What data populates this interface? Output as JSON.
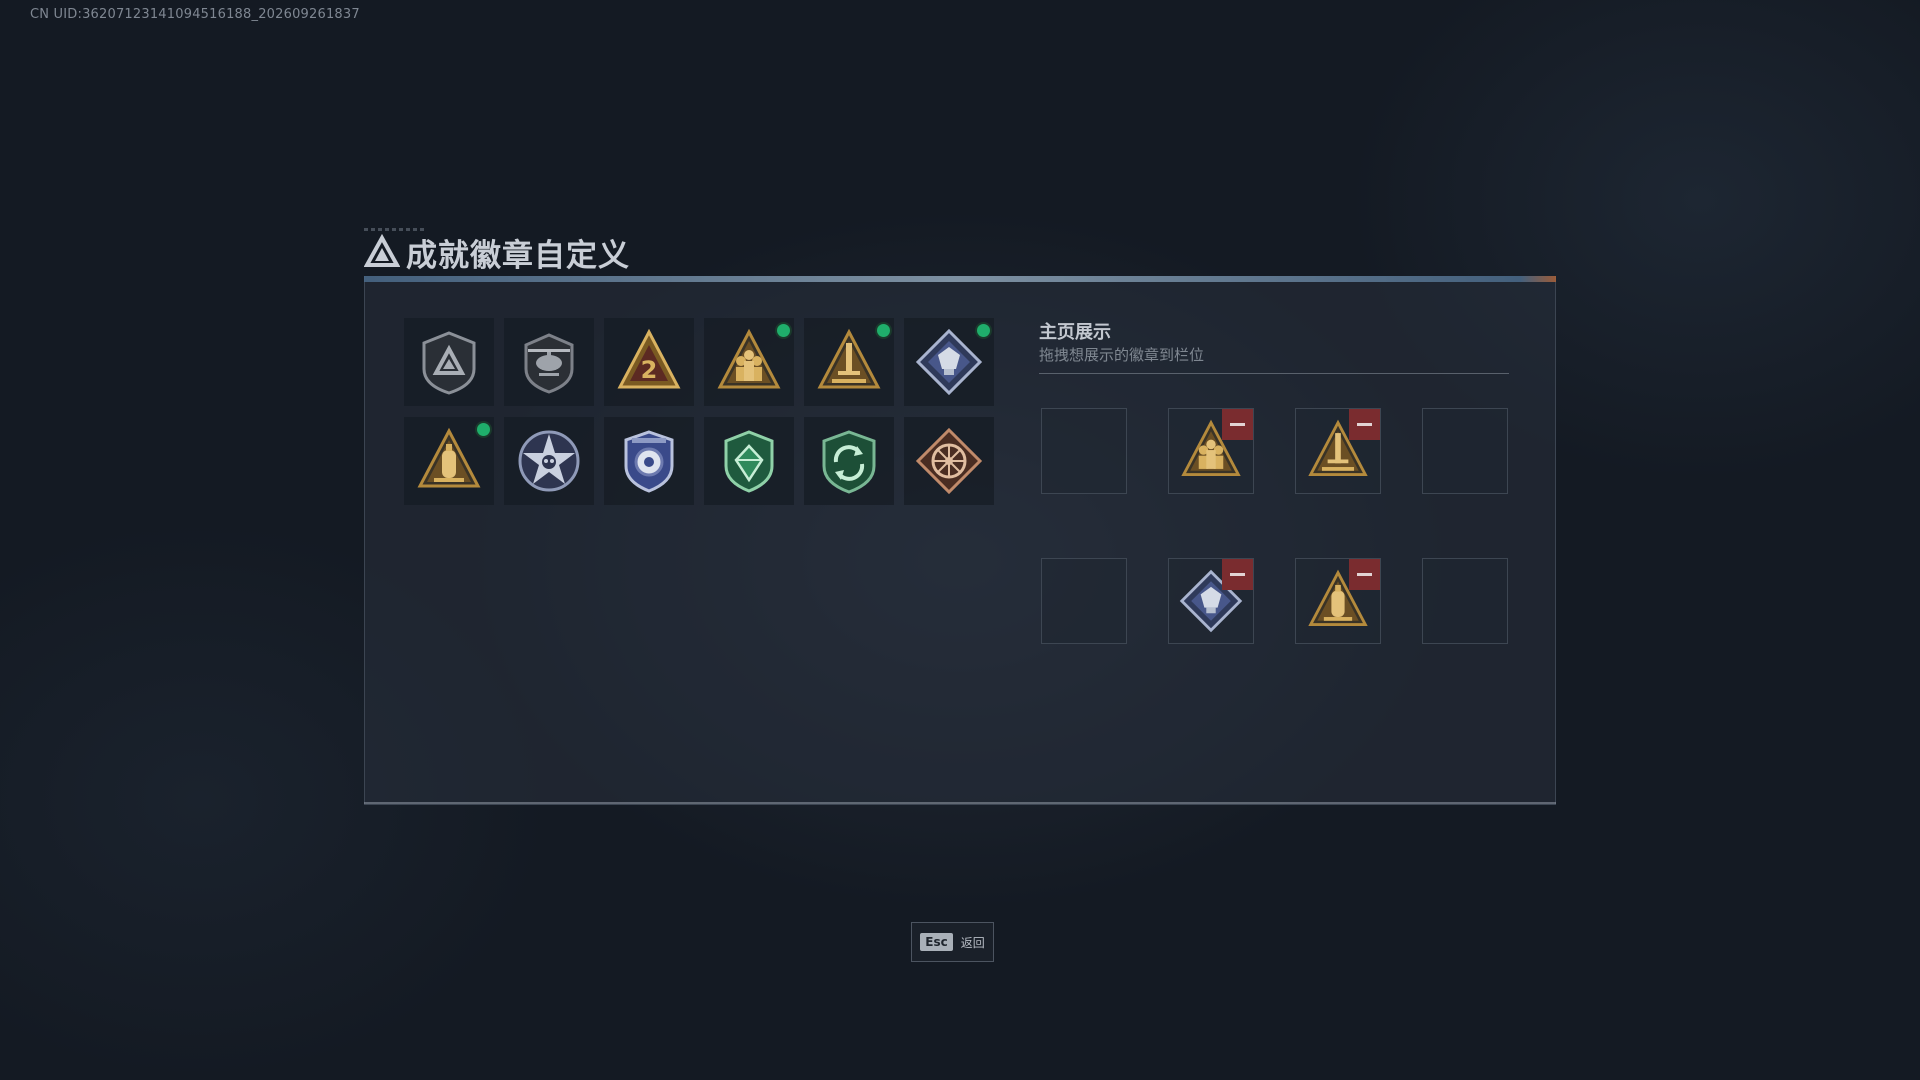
{
  "uid_text": "CN UID:36207123141094516188_202609261837",
  "title": "成就徽章自定义",
  "showcase": {
    "title": "主页展示",
    "subtitle": "拖拽想展示的徽章到栏位"
  },
  "badges": [
    {
      "icon": "triangle-shield-badge-icon",
      "equipped": false
    },
    {
      "icon": "helicopter-shield-badge-icon",
      "equipped": false
    },
    {
      "icon": "number-2-triangle-badge-icon",
      "equipped": false
    },
    {
      "icon": "soldiers-triangle-badge-icon",
      "equipped": true
    },
    {
      "icon": "sword-triangle-badge-icon",
      "equipped": true
    },
    {
      "icon": "diamond-emblem-badge-icon",
      "equipped": true
    },
    {
      "icon": "oxygen-tank-triangle-badge-icon",
      "equipped": true
    },
    {
      "icon": "star-skull-badge-icon",
      "equipped": false
    },
    {
      "icon": "blue-police-badge-icon",
      "equipped": false
    },
    {
      "icon": "green-gem-shield-badge-icon",
      "equipped": false
    },
    {
      "icon": "green-cycle-shield-badge-icon",
      "equipped": false
    },
    {
      "icon": "wheel-diamond-badge-icon",
      "equipped": false
    }
  ],
  "slots": [
    {
      "filled": false
    },
    {
      "filled": true,
      "icon": "soldiers-triangle-badge-icon"
    },
    {
      "filled": true,
      "icon": "sword-triangle-badge-icon"
    },
    {
      "filled": false
    },
    {
      "filled": false
    },
    {
      "filled": true,
      "icon": "diamond-emblem-badge-icon"
    },
    {
      "filled": true,
      "icon": "oxygen-tank-triangle-badge-icon"
    },
    {
      "filled": false
    }
  ],
  "footer": {
    "esc_key": "Esc",
    "back_label": "返回"
  },
  "colors": {
    "background": "#141a23",
    "equipped_dot": "#1fae6b",
    "remove_button": "#7a2c2f",
    "gold": "#b48a3c",
    "accent_orange": "#b0653a"
  }
}
